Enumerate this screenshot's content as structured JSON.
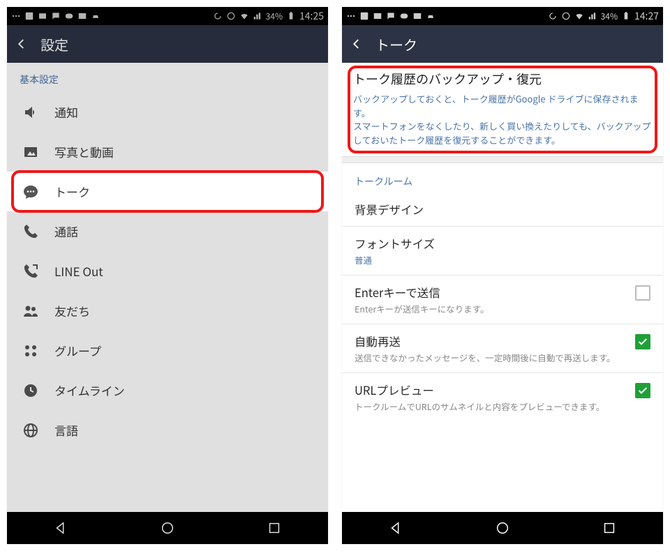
{
  "left": {
    "status": {
      "battery": "34%",
      "time": "14:25"
    },
    "header_title": "設定",
    "section": "基本設定",
    "items": {
      "notify": "通知",
      "photo": "写真と動画",
      "talk": "トーク",
      "call": "通話",
      "lineout": "LINE Out",
      "friends": "友だち",
      "group": "グループ",
      "timeline": "タイムライン",
      "lang": "言語"
    }
  },
  "right": {
    "status": {
      "battery": "34%",
      "time": "14:27"
    },
    "header_title": "トーク",
    "backup": {
      "title": "トーク履歴のバックアップ・復元",
      "desc": "バックアップしておくと、トーク履歴がGoogle ドライブに保存されます。\nスマートフォンをなくしたり、新しく買い換えたりしても、バックアップしておいたトーク履歴を復元することができます。"
    },
    "section": "トークルーム",
    "bg": {
      "title": "背景デザイン"
    },
    "font": {
      "title": "フォントサイズ",
      "value": "普通"
    },
    "enter": {
      "title": "Enterキーで送信",
      "sub": "Enterキーが送信キーになります。"
    },
    "resend": {
      "title": "自動再送",
      "sub": "送信できなかったメッセージを、一定時間後に自動で再送します。"
    },
    "urlprev": {
      "title": "URLプレビュー",
      "sub": "トークルームでURLのサムネイルと内容をプレビューできます。"
    }
  }
}
